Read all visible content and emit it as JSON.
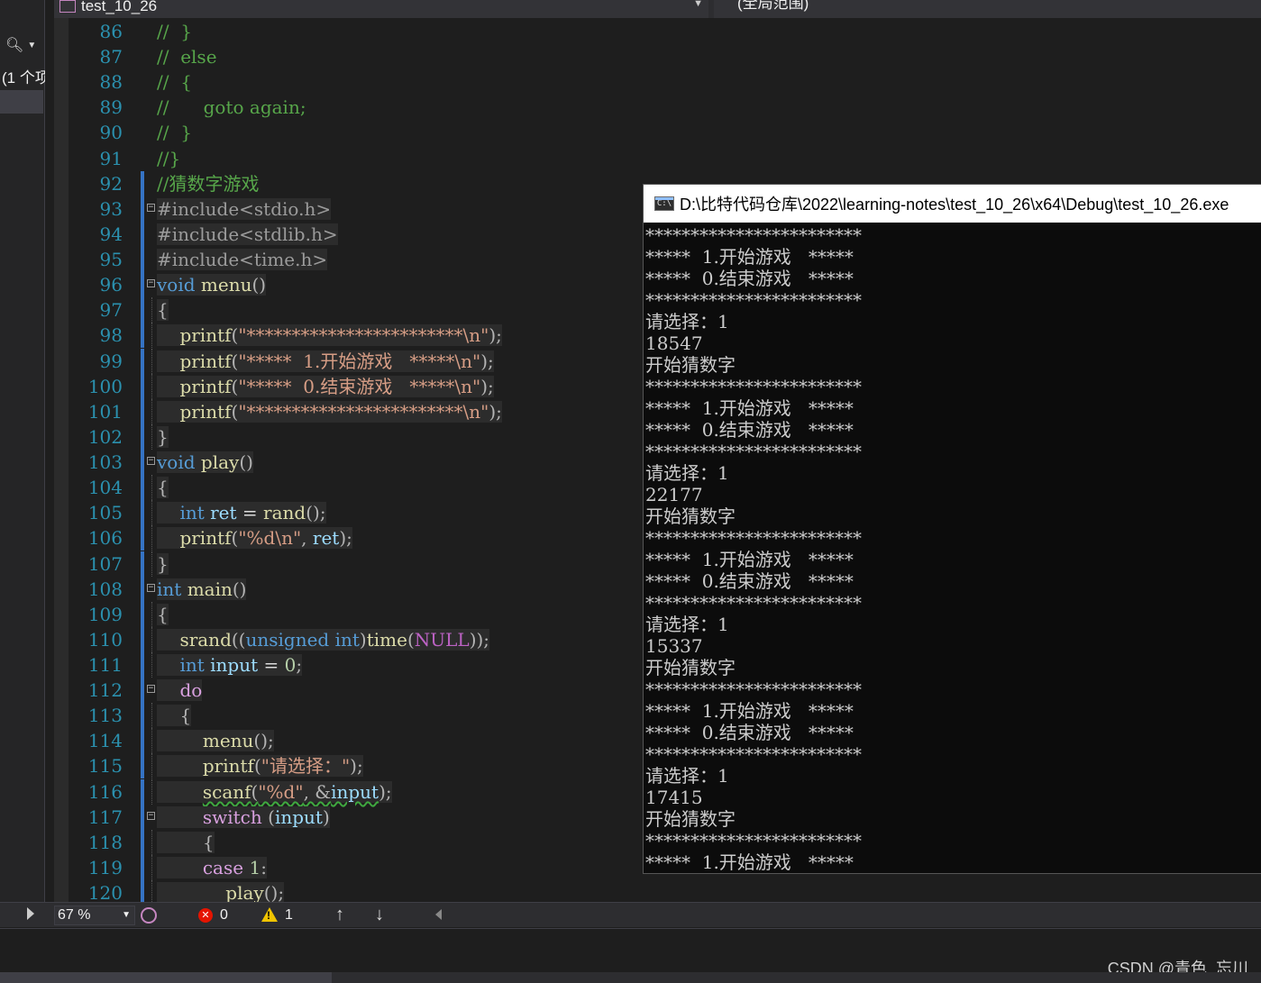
{
  "left_panel": {
    "search_icon": "search-icon",
    "result_count": "(1 个项"
  },
  "navbar": {
    "file_label": "test_10_26",
    "scope_label": "(全局范围)"
  },
  "editor": {
    "lines": [
      {
        "n": "86",
        "segs": [
          [
            "c-cmt",
            "//  }"
          ]
        ]
      },
      {
        "n": "87",
        "segs": [
          [
            "c-cmt",
            "//  else"
          ]
        ]
      },
      {
        "n": "88",
        "segs": [
          [
            "c-cmt",
            "//  {"
          ]
        ]
      },
      {
        "n": "89",
        "segs": [
          [
            "c-cmt",
            "//      goto again;"
          ]
        ]
      },
      {
        "n": "90",
        "segs": [
          [
            "c-cmt",
            "//  }"
          ]
        ]
      },
      {
        "n": "91",
        "segs": [
          [
            "c-cmt",
            "//}"
          ]
        ]
      },
      {
        "n": "92",
        "segs": [
          [
            "c-cmt",
            "//猜数字游戏"
          ]
        ]
      },
      {
        "n": "93",
        "fold": true,
        "segs": [
          [
            "c-pre",
            "#include<stdio.h>"
          ]
        ]
      },
      {
        "n": "94",
        "segs": [
          [
            "c-pre",
            "#include<stdlib.h>"
          ]
        ]
      },
      {
        "n": "95",
        "segs": [
          [
            "c-pre",
            "#include<time.h>"
          ]
        ]
      },
      {
        "n": "96",
        "fold": true,
        "segs": [
          [
            "c-kw",
            "void"
          ],
          [
            "",
            " "
          ],
          [
            "c-fn",
            "menu"
          ],
          [
            "c-punc",
            "()"
          ]
        ]
      },
      {
        "n": "97",
        "segs": [
          [
            "c-punc",
            "{"
          ]
        ]
      },
      {
        "n": "98",
        "segs": [
          [
            "",
            "    "
          ],
          [
            "c-fn",
            "printf"
          ],
          [
            "c-punc",
            "("
          ],
          [
            "c-str",
            "\"************************\\n\""
          ],
          [
            "c-punc",
            ");"
          ]
        ]
      },
      {
        "n": "99",
        "segs": [
          [
            "",
            "    "
          ],
          [
            "c-fn",
            "printf"
          ],
          [
            "c-punc",
            "("
          ],
          [
            "c-str",
            "\"*****  1.开始游戏   *****\\n\""
          ],
          [
            "c-punc",
            ");"
          ]
        ]
      },
      {
        "n": "100",
        "segs": [
          [
            "",
            "    "
          ],
          [
            "c-fn",
            "printf"
          ],
          [
            "c-punc",
            "("
          ],
          [
            "c-str",
            "\"*****  0.结束游戏   *****\\n\""
          ],
          [
            "c-punc",
            ");"
          ]
        ]
      },
      {
        "n": "101",
        "segs": [
          [
            "",
            "    "
          ],
          [
            "c-fn",
            "printf"
          ],
          [
            "c-punc",
            "("
          ],
          [
            "c-str",
            "\"************************\\n\""
          ],
          [
            "c-punc",
            ");"
          ]
        ]
      },
      {
        "n": "102",
        "segs": [
          [
            "c-punc",
            "}"
          ]
        ]
      },
      {
        "n": "103",
        "fold": true,
        "segs": [
          [
            "c-kw",
            "void"
          ],
          [
            "",
            " "
          ],
          [
            "c-fn",
            "play"
          ],
          [
            "c-punc",
            "()"
          ]
        ]
      },
      {
        "n": "104",
        "segs": [
          [
            "c-punc",
            "{"
          ]
        ]
      },
      {
        "n": "105",
        "segs": [
          [
            "",
            "    "
          ],
          [
            "c-kw",
            "int"
          ],
          [
            "",
            " "
          ],
          [
            "c-var",
            "ret"
          ],
          [
            "",
            " = "
          ],
          [
            "c-fn",
            "rand"
          ],
          [
            "c-punc",
            "();"
          ]
        ]
      },
      {
        "n": "106",
        "segs": [
          [
            "",
            "    "
          ],
          [
            "c-fn",
            "printf"
          ],
          [
            "c-punc",
            "("
          ],
          [
            "c-str",
            "\"%d\\n\""
          ],
          [
            "c-punc",
            ", "
          ],
          [
            "c-var",
            "ret"
          ],
          [
            "c-punc",
            ");"
          ]
        ]
      },
      {
        "n": "107",
        "segs": [
          [
            "c-punc",
            "}"
          ]
        ]
      },
      {
        "n": "108",
        "fold": true,
        "segs": [
          [
            "c-kw",
            "int"
          ],
          [
            "",
            " "
          ],
          [
            "c-fn",
            "main"
          ],
          [
            "c-punc",
            "()"
          ]
        ]
      },
      {
        "n": "109",
        "segs": [
          [
            "c-punc",
            "{"
          ]
        ]
      },
      {
        "n": "110",
        "segs": [
          [
            "",
            "    "
          ],
          [
            "c-fn",
            "srand"
          ],
          [
            "c-punc",
            "(("
          ],
          [
            "c-kw",
            "unsigned int"
          ],
          [
            "c-punc",
            ")"
          ],
          [
            "c-fn",
            "time"
          ],
          [
            "c-punc",
            "("
          ],
          [
            "c-mac",
            "NULL"
          ],
          [
            "c-punc",
            "));"
          ]
        ]
      },
      {
        "n": "111",
        "segs": [
          [
            "",
            "    "
          ],
          [
            "c-kw",
            "int"
          ],
          [
            "",
            " "
          ],
          [
            "c-var",
            "input"
          ],
          [
            "",
            " = "
          ],
          [
            "c-num",
            "0"
          ],
          [
            "c-punc",
            ";"
          ]
        ]
      },
      {
        "n": "112",
        "fold": true,
        "foldIndent": true,
        "segs": [
          [
            "",
            "    "
          ],
          [
            "c-kw2",
            "do"
          ]
        ]
      },
      {
        "n": "113",
        "segs": [
          [
            "",
            "    "
          ],
          [
            "c-punc",
            "{"
          ]
        ]
      },
      {
        "n": "114",
        "segs": [
          [
            "",
            "        "
          ],
          [
            "c-fn",
            "menu"
          ],
          [
            "c-punc",
            "();"
          ]
        ]
      },
      {
        "n": "115",
        "segs": [
          [
            "",
            "        "
          ],
          [
            "c-fn",
            "printf"
          ],
          [
            "c-punc",
            "("
          ],
          [
            "c-str",
            "\"请选择：\""
          ],
          [
            "c-punc",
            ");"
          ]
        ]
      },
      {
        "n": "116",
        "segs": [
          [
            "",
            "        "
          ],
          [
            "c-fn squig",
            "scanf"
          ],
          [
            "c-punc squig",
            "("
          ],
          [
            "c-str squig",
            "\"%d\""
          ],
          [
            "c-punc squig",
            ", &"
          ],
          [
            "c-var squig",
            "input"
          ],
          [
            "c-punc",
            ");"
          ]
        ]
      },
      {
        "n": "117",
        "fold": true,
        "foldIndent": true,
        "segs": [
          [
            "",
            "        "
          ],
          [
            "c-kw2",
            "switch"
          ],
          [
            "",
            " "
          ],
          [
            "c-punc",
            "("
          ],
          [
            "c-var",
            "input"
          ],
          [
            "c-punc",
            ")"
          ]
        ]
      },
      {
        "n": "118",
        "segs": [
          [
            "",
            "        "
          ],
          [
            "c-punc",
            "{"
          ]
        ]
      },
      {
        "n": "119",
        "segs": [
          [
            "",
            "        "
          ],
          [
            "c-kw2",
            "case"
          ],
          [
            "",
            " "
          ],
          [
            "c-num",
            "1"
          ],
          [
            "c-punc",
            ":"
          ]
        ]
      },
      {
        "n": "120",
        "segs": [
          [
            "",
            "            "
          ],
          [
            "c-fn",
            "play"
          ],
          [
            "c-punc",
            "();"
          ]
        ]
      }
    ]
  },
  "status_bar": {
    "zoom": "67 %",
    "errors": "0",
    "warnings": "1",
    "error_icon": "error-icon",
    "warning_icon": "warning-icon",
    "up_icon": "arrow-up-icon",
    "down_icon": "arrow-down-icon"
  },
  "console": {
    "title": "D:\\比特代码仓库\\2022\\learning-notes\\test_10_26\\x64\\Debug\\test_10_26.exe",
    "icon_label": "C:\\",
    "lines": [
      "************************",
      "*****  1.开始游戏   *****",
      "*****  0.结束游戏   *****",
      "************************",
      "请选择：1",
      "18547",
      "开始猜数字",
      "************************",
      "*****  1.开始游戏   *****",
      "*****  0.结束游戏   *****",
      "************************",
      "请选择：1",
      "22177",
      "开始猜数字",
      "************************",
      "*****  1.开始游戏   *****",
      "*****  0.结束游戏   *****",
      "************************",
      "请选择：1",
      "15337",
      "开始猜数字",
      "************************",
      "*****  1.开始游戏   *****",
      "*****  0.结束游戏   *****",
      "************************",
      "请选择：1",
      "17415",
      "开始猜数字",
      "************************",
      "*****  1.开始游戏   *****"
    ]
  },
  "watermark": "CSDN @青色_忘川"
}
